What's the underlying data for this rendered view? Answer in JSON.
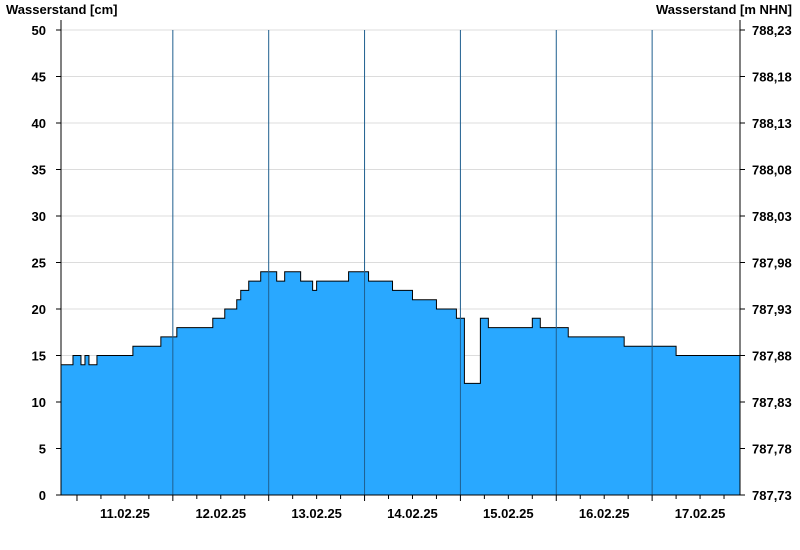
{
  "chart_data": {
    "type": "area",
    "ylabel_left": "Wasserstand [cm]",
    "ylabel_right": "Wasserstand [m NHN]",
    "x_labels": [
      "11.02.25",
      "12.02.25",
      "13.02.25",
      "14.02.25",
      "15.02.25",
      "16.02.25",
      "17.02.25"
    ],
    "x_range": [
      "10.02.25 20:00",
      "17.02.25 22:00"
    ],
    "ylim": [
      0,
      50
    ],
    "y_ticks": [
      0,
      5,
      10,
      15,
      20,
      25,
      30,
      35,
      40,
      45,
      50
    ],
    "y2_ticks": [
      "787,73",
      "787,78",
      "787,83",
      "787,88",
      "787,93",
      "787,98",
      "788,03",
      "788,08",
      "788,13",
      "788,18",
      "788,23"
    ],
    "grid": true,
    "fill_color": "#29a8ff",
    "line_color": "#000000",
    "day_separators": [
      "11.02.25 24:00",
      "12.02.25 24:00",
      "13.02.25 24:00",
      "14.02.25 24:00",
      "15.02.25 24:00",
      "16.02.25 24:00"
    ],
    "series": [
      {
        "x": [
          "10.02.25 20:00",
          "10.02.25 22:00",
          "10.02.25 23:00",
          "11.02.25 01:00",
          "11.02.25 02:00",
          "11.02.25 03:00",
          "11.02.25 05:00",
          "11.02.25 08:00",
          "11.02.25 14:00",
          "11.02.25 17:00",
          "11.02.25 21:00",
          "11.02.25 23:00",
          "12.02.25 01:00",
          "12.02.25 05:00",
          "12.02.25 10:00",
          "12.02.25 13:00",
          "12.02.25 16:00",
          "12.02.25 17:00",
          "12.02.25 19:00",
          "12.02.25 22:00",
          "13.02.25 02:00",
          "13.02.25 04:00",
          "13.02.25 08:00",
          "13.02.25 10:00",
          "13.02.25 11:00",
          "13.02.25 12:00",
          "13.02.25 15:00",
          "13.02.25 20:00",
          "13.02.25 22:00",
          "14.02.25 01:00",
          "14.02.25 04:00",
          "14.02.25 07:00",
          "14.02.25 12:00",
          "14.02.25 18:00",
          "14.02.25 19:00",
          "14.02.25 23:00",
          "15.02.25 00:00",
          "15.02.25 01:00",
          "15.02.25 05:00",
          "15.02.25 07:00",
          "15.02.25 12:00",
          "15.02.25 18:00",
          "15.02.25 20:00",
          "16.02.25 00:00",
          "16.02.25 03:00",
          "16.02.25 10:00",
          "16.02.25 15:00",
          "16.02.25 17:00",
          "16.02.25 20:00",
          "17.02.25 00:00",
          "17.02.25 03:00",
          "17.02.25 06:00",
          "17.02.25 10:00",
          "17.02.25 16:00",
          "17.02.25 22:00"
        ],
        "values": [
          14,
          14,
          15,
          14,
          15,
          14,
          15,
          15,
          16,
          16,
          17,
          17,
          18,
          18,
          19,
          20,
          21,
          22,
          23,
          24,
          23,
          24,
          23,
          23,
          22,
          23,
          23,
          24,
          24,
          23,
          23,
          22,
          21,
          20,
          20,
          19,
          19,
          12,
          19,
          18,
          18,
          19,
          18,
          18,
          17,
          17,
          17,
          16,
          16,
          16,
          16,
          15,
          15,
          15,
          15
        ]
      }
    ]
  }
}
